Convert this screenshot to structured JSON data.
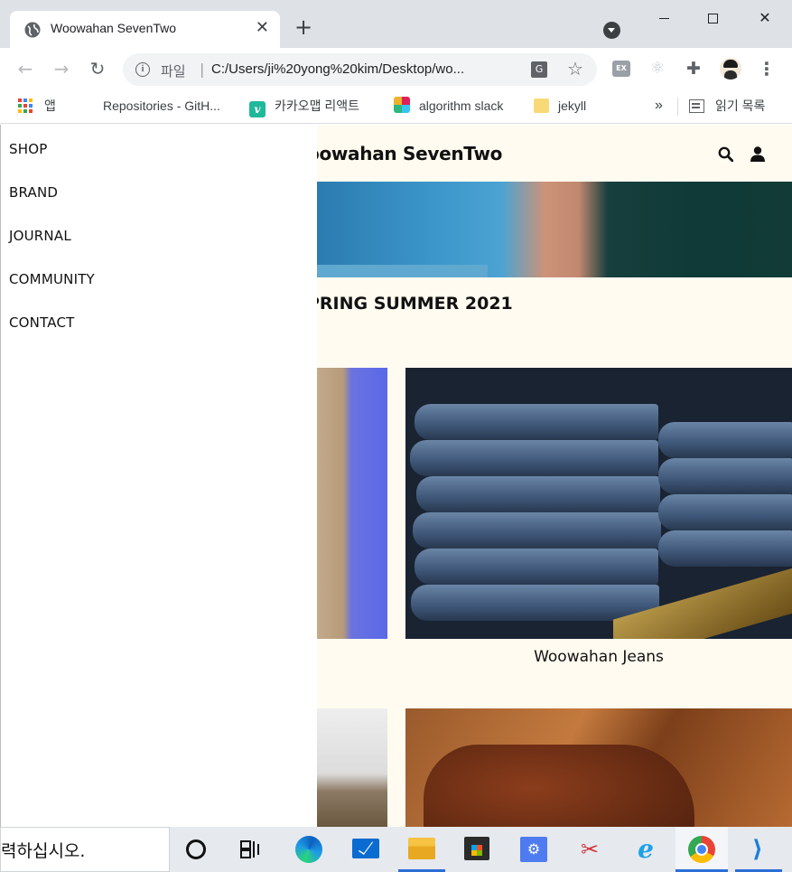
{
  "browser": {
    "tab_title": "Woowahan SevenTwo",
    "tab_close": "✕",
    "new_tab": "+",
    "url_scheme": "파일",
    "url_separator": "|",
    "url": "C:/Users/ji%20yong%20kim/Desktop/wo...",
    "window_controls": [
      "minimize",
      "maximize",
      "close"
    ]
  },
  "bookmarks": {
    "apps": "앱",
    "items": [
      {
        "label": "Repositories - GitH...",
        "icon": "github-icon"
      },
      {
        "label": "카카오맵 리액트",
        "icon": "v-icon"
      },
      {
        "label": "algorithm slack",
        "icon": "slack-icon"
      },
      {
        "label": "jekyll",
        "icon": "folder-icon"
      }
    ],
    "more": "»",
    "reading_list": "읽기 목록"
  },
  "site": {
    "title": "Woowahan SevenTwo",
    "title_visible": "oowahan SevenTwo",
    "season_heading": "PRING SUMMER 2021",
    "jeans_caption": "Woowahan Jeans"
  },
  "side_menu": {
    "items": [
      "SHOP",
      "BRAND",
      "JOURNAL",
      "COMMUNITY",
      "CONTACT"
    ]
  },
  "taskbar": {
    "search_text": "력하십시오."
  },
  "colors": {
    "page_background": "#fffbf0",
    "menu_background": "#ffffff",
    "tabstrip": "#dee1e6"
  }
}
